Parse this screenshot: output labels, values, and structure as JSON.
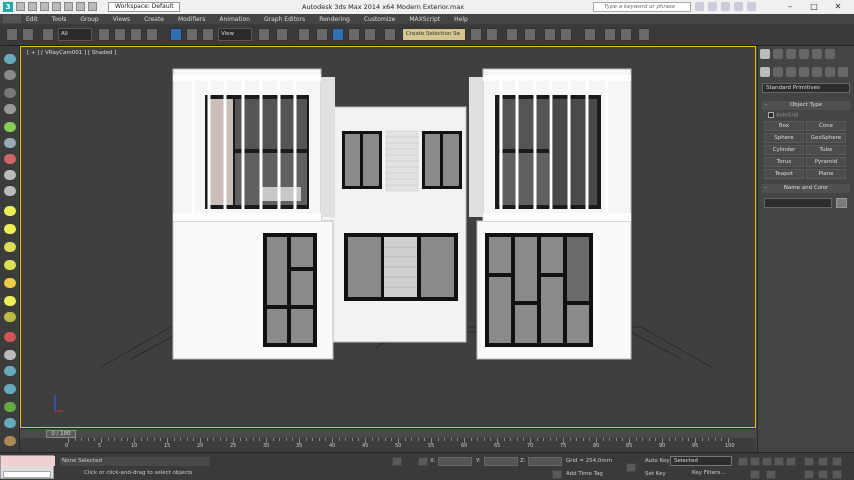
{
  "titlebar": {
    "logo": "3",
    "workspace": "Workspace: Default",
    "app_title": "Autodesk 3ds Max  2014 x64     Modern Exterior.max",
    "search_placeholder": "Type a keyword or phrase",
    "window_controls": [
      "–",
      "□",
      "✕"
    ]
  },
  "menu": [
    "Edit",
    "Tools",
    "Group",
    "Views",
    "Create",
    "Modifiers",
    "Animation",
    "Graph Editors",
    "Rendering",
    "Customize",
    "MAXScript",
    "Help"
  ],
  "toolbar": {
    "selection_filter": "All",
    "ref_coord": "View",
    "create_selection_set": "Create Selection Se"
  },
  "viewport": {
    "label": "[ + ] [ VRayCam001 ] [ Shaded ]"
  },
  "command_panel": {
    "category": "Standard Primitives",
    "object_type_header": "Object Type",
    "autogrid": "AutoGrid",
    "objects": [
      "Box",
      "Cone",
      "Sphere",
      "GeoSphere",
      "Cylinder",
      "Tube",
      "Torus",
      "Pyramid",
      "Teapot",
      "Plane"
    ],
    "name_color_header": "Name and Color"
  },
  "timeline": {
    "frame_display": "0 / 100",
    "ticks": [
      "0",
      "5",
      "10",
      "15",
      "20",
      "25",
      "30",
      "35",
      "40",
      "45",
      "50",
      "55",
      "60",
      "65",
      "70",
      "75",
      "80",
      "85",
      "90",
      "95",
      "100"
    ]
  },
  "status": {
    "selection": "None Selected",
    "prompt": "Click or click-and-drag to select objects",
    "x_label": "X:",
    "y_label": "Y:",
    "z_label": "Z:",
    "grid": "Grid = 254,0mm",
    "add_time_tag": "Add Time Tag",
    "auto_key": "Auto Key",
    "set_key": "Set Key",
    "selected_mode": "Selected",
    "key_filters": "Key Filters..."
  },
  "colors": {
    "viewport_border": "#f0c000",
    "ui_bg": "#444444",
    "toolbar_active": "#2f6fb4"
  }
}
